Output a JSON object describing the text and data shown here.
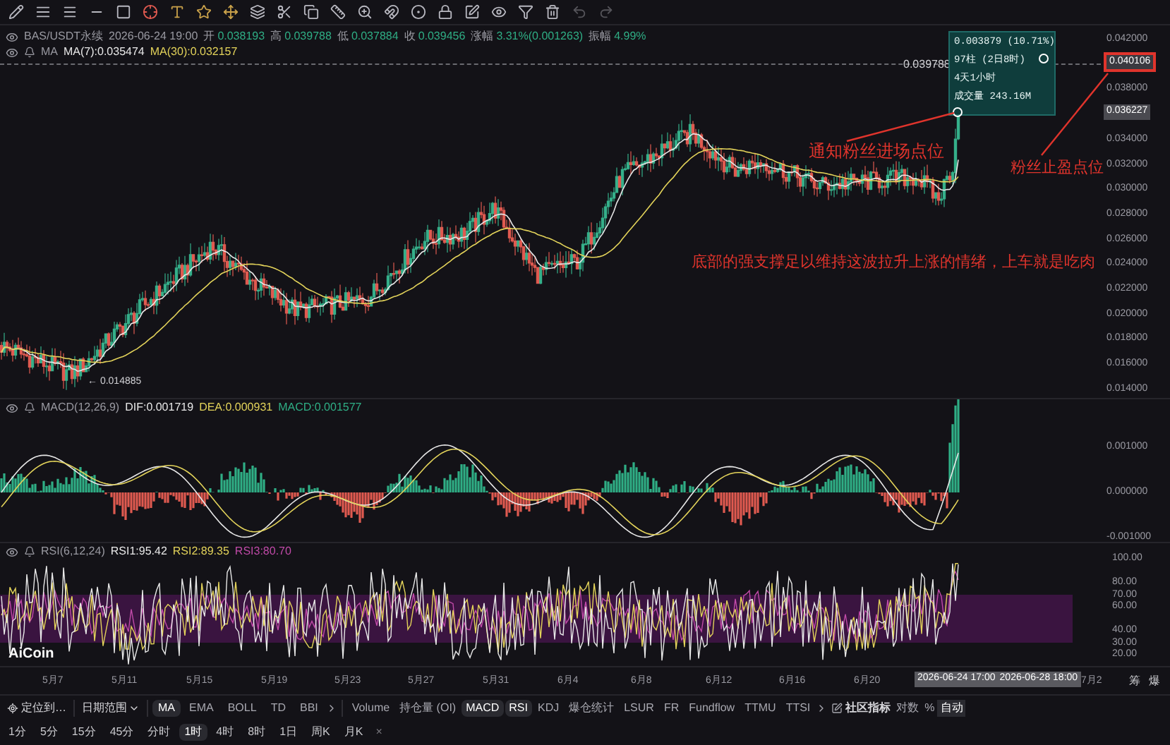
{
  "symbol_info": {
    "pair": "BAS/USDT永续",
    "time": "2026-06-24 19:00",
    "fields": [
      {
        "label": "开",
        "value": "0.038193"
      },
      {
        "label": "高",
        "value": "0.039788"
      },
      {
        "label": "低",
        "value": "0.037884"
      },
      {
        "label": "收",
        "value": "0.039456"
      },
      {
        "label": "涨幅",
        "value": "3.31%(0.001263)"
      },
      {
        "label": "振幅",
        "value": "4.99%"
      }
    ]
  },
  "ma_info": {
    "name": "MA",
    "values": [
      {
        "text": "MA(7):0.035474",
        "color": "#e8e8e8"
      },
      {
        "text": "MA(30):0.032157",
        "color": "#e3d35a"
      }
    ]
  },
  "price_axis": {
    "labels": [
      "0.042000",
      "0.038000",
      "0.034000",
      "0.032000",
      "0.030000",
      "0.028000",
      "0.026000",
      "0.024000",
      "0.022000",
      "0.020000",
      "0.018000",
      "0.016000",
      "0.014000"
    ],
    "current_price": "0.040106",
    "last_marker": "0.036227"
  },
  "high_label": "0.039788",
  "low_label": "← 0.014885",
  "tooltip": {
    "lines": [
      "0.003879 (10.71%)",
      "97柱 (2日8时)",
      "4天1小时",
      "成交量 243.16M"
    ]
  },
  "annotations": [
    {
      "kind": "entry",
      "text": "通知粉丝进场点位"
    },
    {
      "kind": "takeprofit",
      "text": "粉丝止盈点位"
    },
    {
      "kind": "note",
      "text": "底部的强支撑足以维持这波拉升上涨的情绪，上车就是吃肉"
    }
  ],
  "macd": {
    "title": "MACD(12,26,9)",
    "values": [
      {
        "text": "DIF:0.001719",
        "color": "#e8e8e8"
      },
      {
        "text": "DEA:0.000931",
        "color": "#e3d35a"
      },
      {
        "text": "MACD:0.001577",
        "color": "#2fae85"
      }
    ],
    "axis": [
      "0.001000",
      "0.000000",
      "-0.001000"
    ]
  },
  "rsi": {
    "title": "RSI(6,12,24)",
    "values": [
      {
        "text": "RSI1:95.42",
        "color": "#e8e8e8"
      },
      {
        "text": "RSI2:89.35",
        "color": "#e3d35a"
      },
      {
        "text": "RSI3:80.70",
        "color": "#c04aa8"
      }
    ],
    "axis": [
      "100.00",
      "80.00",
      "70.00",
      "60.00",
      "40.00",
      "30.00",
      "20.00"
    ]
  },
  "logo": "AiCoin",
  "time_axis": {
    "labels": [
      "5月7",
      "5月11",
      "5月15",
      "5月19",
      "5月23",
      "5月27",
      "5月31",
      "6月4",
      "6月8",
      "6月12",
      "6月16",
      "6月20"
    ],
    "range_start": "2026-06-24 17:00",
    "range_end": "2026-06-28 18:00",
    "end_label": "7月2",
    "corner_buttons": [
      "筹",
      "爆"
    ]
  },
  "indicator_bar": {
    "locate": "定位到…",
    "date_range": "日期范围",
    "main_indicators": [
      {
        "label": "MA",
        "selected": true
      },
      {
        "label": "EMA",
        "selected": false
      },
      {
        "label": "BOLL",
        "selected": false
      },
      {
        "label": "TD",
        "selected": false
      },
      {
        "label": "BBI",
        "selected": false
      }
    ],
    "sub_indicators": [
      {
        "label": "Volume",
        "selected": false
      },
      {
        "label": "持仓量 (OI)",
        "selected": false
      },
      {
        "label": "MACD",
        "selected": true
      },
      {
        "label": "RSI",
        "selected": true
      },
      {
        "label": "KDJ",
        "selected": false
      },
      {
        "label": "爆仓统计",
        "selected": false
      },
      {
        "label": "LSUR",
        "selected": false
      },
      {
        "label": "FR",
        "selected": false
      },
      {
        "label": "Fundflow",
        "selected": false
      },
      {
        "label": "TTMU",
        "selected": false
      },
      {
        "label": "TTSI",
        "selected": false
      }
    ],
    "community": "社区指标",
    "log": "对数",
    "percent": "%",
    "auto": {
      "label": "自动",
      "selected": true
    }
  },
  "intervals": [
    {
      "label": "1分",
      "selected": false
    },
    {
      "label": "5分",
      "selected": false
    },
    {
      "label": "15分",
      "selected": false
    },
    {
      "label": "45分",
      "selected": false
    },
    {
      "label": "分时",
      "selected": false
    },
    {
      "label": "1时",
      "selected": true
    },
    {
      "label": "4时",
      "selected": false
    },
    {
      "label": "8时",
      "selected": false
    },
    {
      "label": "1日",
      "selected": false
    },
    {
      "label": "周K",
      "selected": false
    },
    {
      "label": "月K",
      "selected": false
    }
  ],
  "close_mark": "×"
}
